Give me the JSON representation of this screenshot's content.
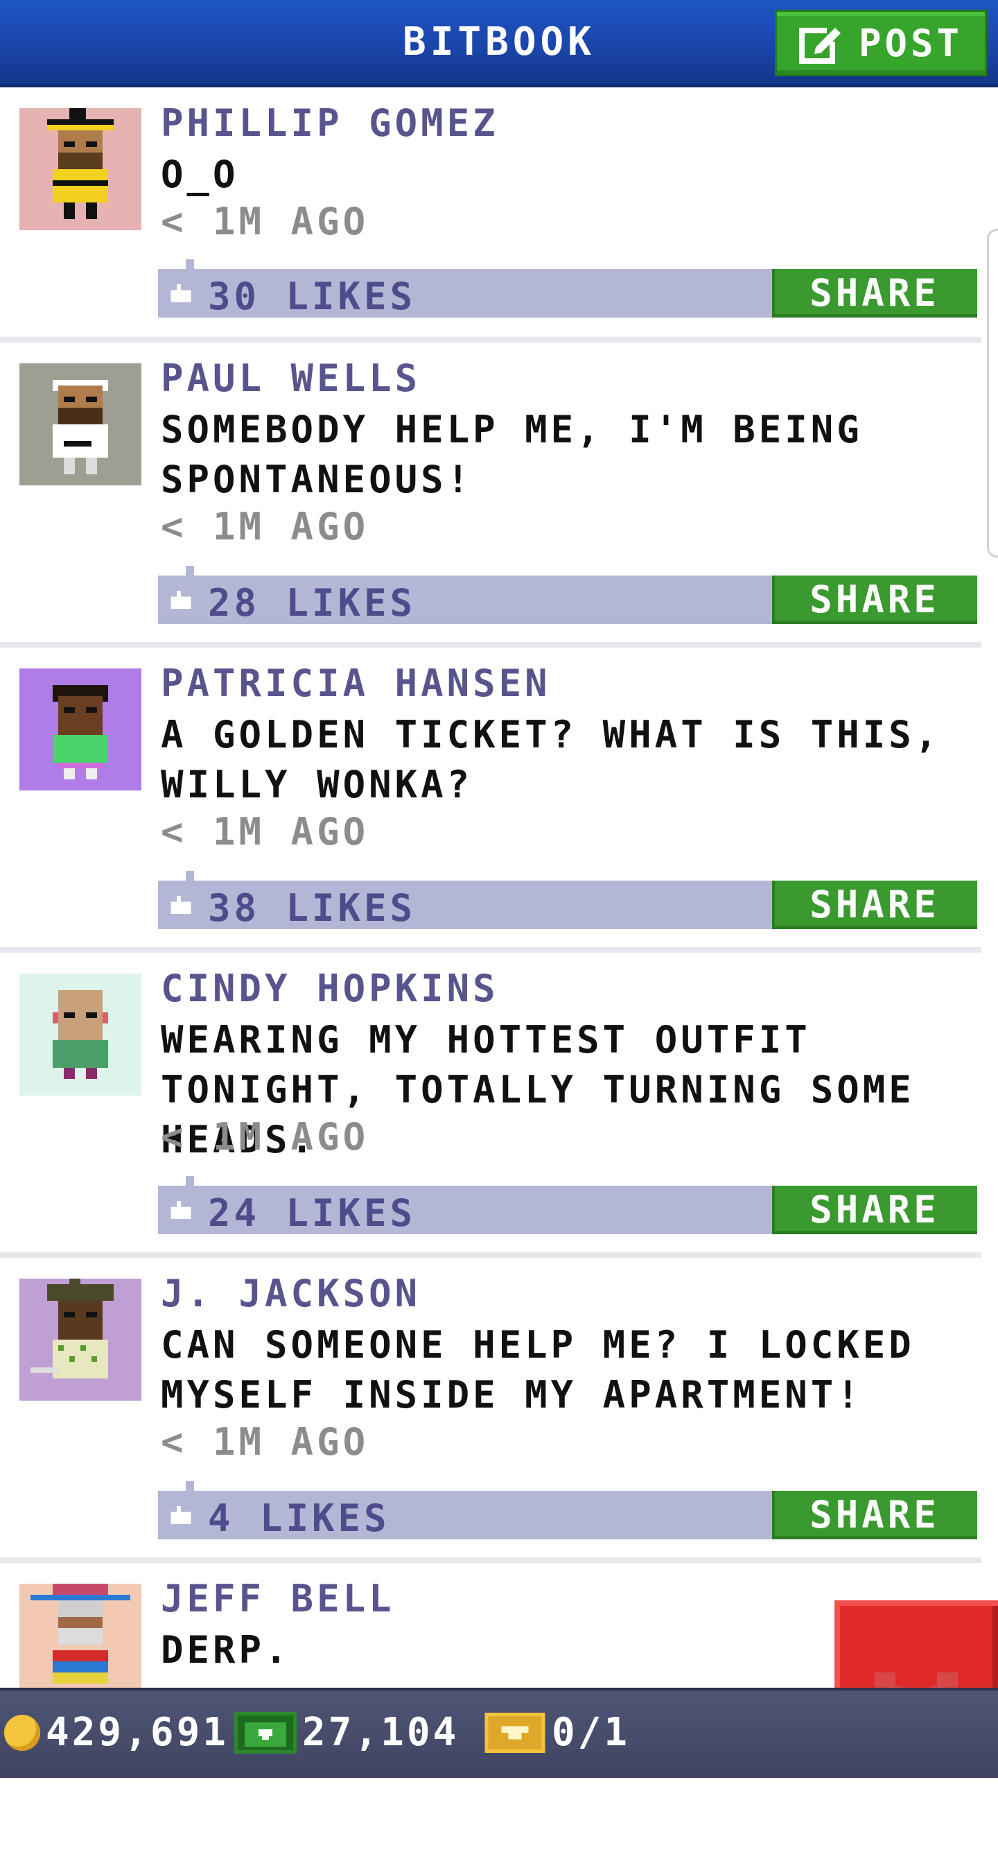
{
  "header": {
    "title": "BITBOOK",
    "post_label": "POST"
  },
  "colors": {
    "header_blue": "#1a44a8",
    "green": "#37a42c",
    "likes_bar": "#b4b6d6",
    "author": "#58558e",
    "close_red": "#e02a2a"
  },
  "posts": [
    {
      "author": "PHILLIP GOMEZ",
      "message": "O_O",
      "time": "< 1M AGO",
      "likes": "30 LIKES",
      "share": "SHARE",
      "avatar_bg": "#e6b2b2"
    },
    {
      "author": "PAUL WELLS",
      "message": "SOMEBODY HELP ME, I'M BEING SPONTANEOUS!",
      "time": "< 1M AGO",
      "likes": "28 LIKES",
      "share": "SHARE",
      "avatar_bg": "#9e9e92"
    },
    {
      "author": "PATRICIA HANSEN",
      "message": "A GOLDEN TICKET? WHAT IS THIS, WILLY WONKA?",
      "time": "< 1M AGO",
      "likes": "38 LIKES",
      "share": "SHARE",
      "avatar_bg": "#b07ce8"
    },
    {
      "author": "CINDY HOPKINS",
      "message": "WEARING MY HOTTEST OUTFIT TONIGHT, TOTALLY TURNING SOME HEADS.",
      "time": "< 1M AGO",
      "likes": "24 LIKES",
      "share": "SHARE",
      "avatar_bg": "#dcf4ea"
    },
    {
      "author": "J. JACKSON",
      "message": "CAN SOMEONE HELP ME? I LOCKED MYSELF INSIDE MY APARTMENT!",
      "time": "< 1M AGO",
      "likes": "4 LIKES",
      "share": "SHARE",
      "avatar_bg": "#c0a0d4"
    },
    {
      "author": "JEFF BELL",
      "message": "DERP.",
      "time": "",
      "likes": "",
      "share": "",
      "avatar_bg": "#f2c9b2"
    }
  ],
  "bottom_bar": {
    "coins": "429,691",
    "bux": "27,104",
    "tickets": "0/1"
  },
  "icons": {
    "post": "edit-icon",
    "like": "thumbs-up-icon",
    "close": "close-icon",
    "coin": "coin-icon",
    "bux": "bux-icon",
    "ticket": "golden-ticket-icon"
  }
}
